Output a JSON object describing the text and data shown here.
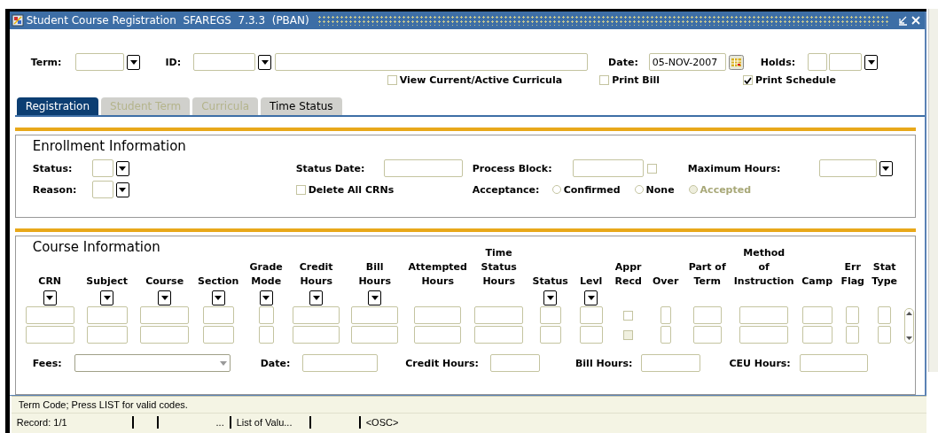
{
  "window": {
    "title": "Student Course Registration  SFAREGS  7.3.3  (PBAN)"
  },
  "key_block": {
    "term": {
      "label": "Term:"
    },
    "id": {
      "label": "ID:"
    },
    "date": {
      "label": "Date:",
      "value": "05-NOV-2007"
    },
    "holds": {
      "label": "Holds:"
    },
    "checkboxes": [
      {
        "label": "View Current/Active Curricula",
        "checked": false
      },
      {
        "label": "Print Bill",
        "checked": false
      },
      {
        "label": "Print Schedule",
        "checked": true
      }
    ]
  },
  "tabs": [
    {
      "label": "Registration",
      "selected": true,
      "disabled": false
    },
    {
      "label": "Student Term",
      "selected": false,
      "disabled": true
    },
    {
      "label": "Curricula",
      "selected": false,
      "disabled": true
    },
    {
      "label": "Time Status",
      "selected": false,
      "disabled": false
    }
  ],
  "enrollment": {
    "title": "Enrollment Information",
    "status": {
      "label": "Status:"
    },
    "reason": {
      "label": "Reason:"
    },
    "status_date": {
      "label": "Status Date:"
    },
    "delete_all": {
      "label": "Delete All CRNs",
      "checked": false
    },
    "process_block": {
      "label": "Process Block:",
      "checked": false
    },
    "maximum_hours": {
      "label": "Maximum Hours:"
    },
    "acceptance": {
      "label": "Acceptance:",
      "options": [
        {
          "label": "Confirmed",
          "selected": false,
          "disabled": false
        },
        {
          "label": "None",
          "selected": false,
          "disabled": false
        },
        {
          "label": "Accepted",
          "selected": false,
          "disabled": true
        }
      ]
    }
  },
  "course": {
    "title": "Course Information",
    "columns": [
      {
        "header": [
          "CRN"
        ],
        "list": true,
        "kind": "field"
      },
      {
        "header": [
          "Subject"
        ],
        "list": true,
        "kind": "field"
      },
      {
        "header": [
          "Course"
        ],
        "list": true,
        "kind": "field"
      },
      {
        "header": [
          "Section"
        ],
        "list": true,
        "kind": "field"
      },
      {
        "header": [
          "Grade",
          "Mode"
        ],
        "list": true,
        "kind": "field"
      },
      {
        "header": [
          "Credit",
          "Hours"
        ],
        "list": true,
        "kind": "field"
      },
      {
        "header": [
          "Bill",
          "Hours"
        ],
        "list": true,
        "kind": "field"
      },
      {
        "header": [
          "Attempted",
          "Hours"
        ],
        "list": false,
        "kind": "field"
      },
      {
        "header": [
          "Time",
          "Status",
          "Hours"
        ],
        "list": false,
        "kind": "field"
      },
      {
        "header": [
          "Status"
        ],
        "list": true,
        "kind": "field"
      },
      {
        "header": [
          "Levl"
        ],
        "list": true,
        "kind": "field"
      },
      {
        "header": [
          "Appr",
          "Recd"
        ],
        "list": false,
        "kind": "checkbox"
      },
      {
        "header": [
          "Over"
        ],
        "list": false,
        "kind": "field"
      },
      {
        "header": [
          "Part of",
          "Term"
        ],
        "list": false,
        "kind": "field"
      },
      {
        "header": [
          "Method",
          "of",
          "Instruction"
        ],
        "list": false,
        "kind": "field"
      },
      {
        "header": [
          "Camp"
        ],
        "list": false,
        "kind": "field"
      },
      {
        "header": [
          "Err",
          "Flag"
        ],
        "list": false,
        "kind": "field"
      },
      {
        "header": [
          "Stat",
          "Type"
        ],
        "list": false,
        "kind": "field"
      }
    ],
    "rows": [
      {
        "checkbox_disabled": false
      },
      {
        "checkbox_disabled": true
      }
    ],
    "fees": {
      "label": "Fees:"
    },
    "date": {
      "label": "Date:"
    },
    "credit_hours": {
      "label": "Credit Hours:"
    },
    "bill_hours": {
      "label": "Bill Hours:"
    },
    "ceu_hours": {
      "label": "CEU Hours:"
    }
  },
  "status_bar": {
    "message": "Term Code; Press LIST for valid codes.",
    "record": "Record: 1/1",
    "ellipsis": "...",
    "list_hint": "List of Valu...",
    "mode": "<OSC>"
  }
}
